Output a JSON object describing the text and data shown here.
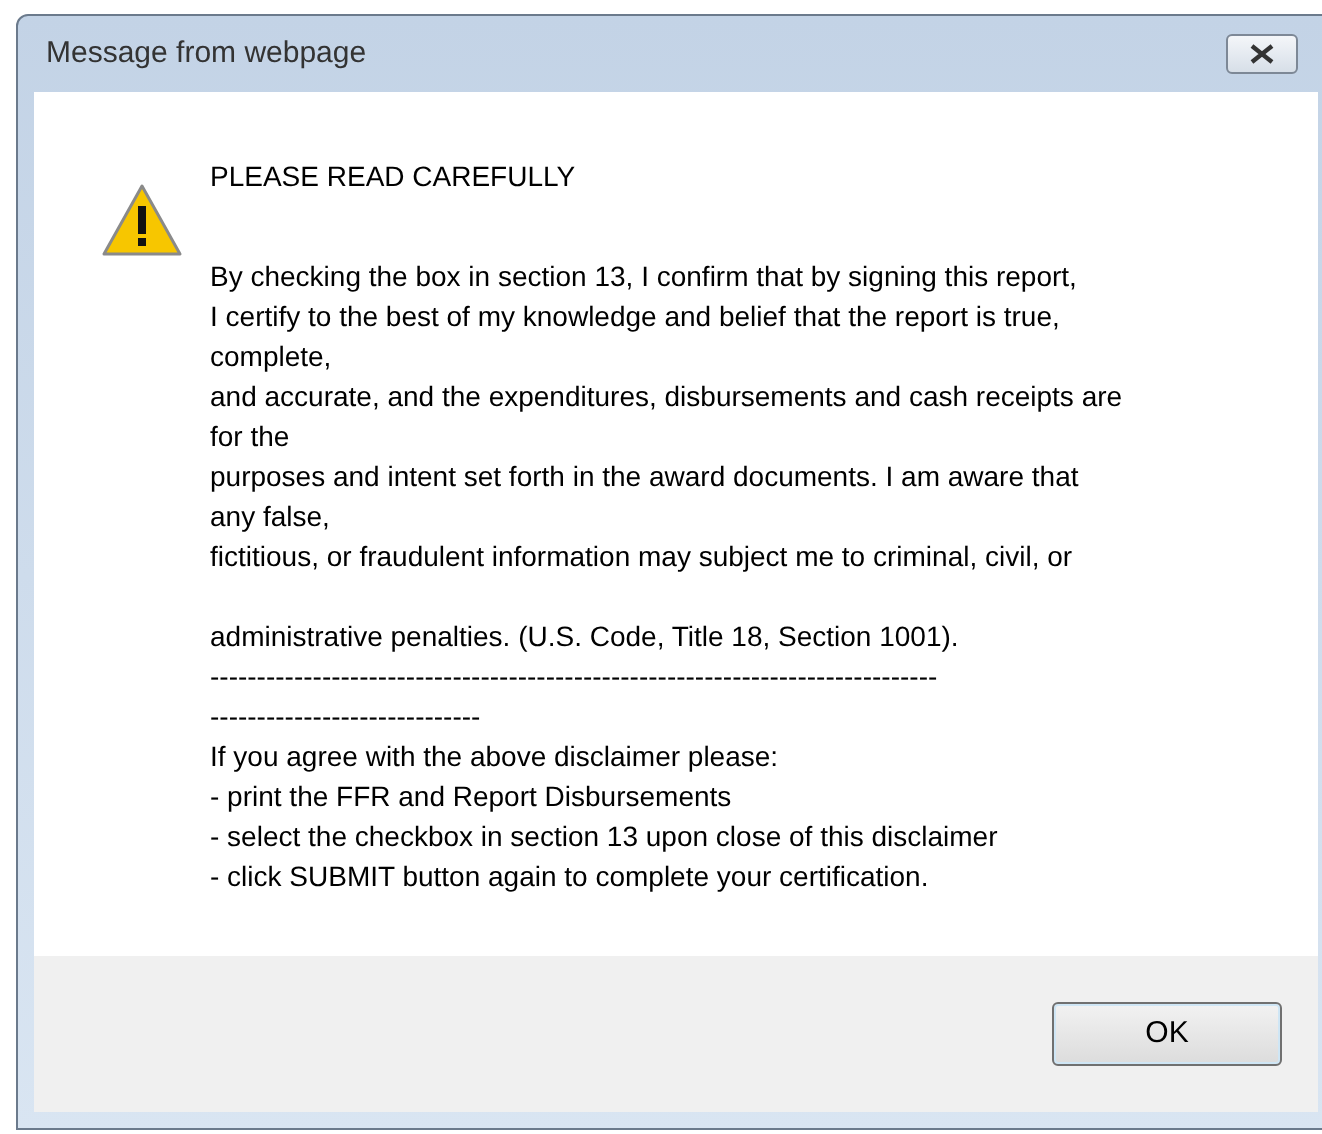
{
  "window": {
    "title": "Message from webpage"
  },
  "heading": "PLEASE READ CAREFULLY",
  "paragraphs": [
    [
      "By checking the box in section 13, I confirm that by signing this report,",
      "I certify to the best of my knowledge and belief that the report is true,",
      "complete,",
      "and accurate, and the expenditures, disbursements and cash receipts are",
      "for the",
      "purposes and intent set forth in the award documents. I am aware that",
      "any false,",
      "fictitious, or fraudulent information may subject me to criminal, civil, or"
    ],
    [
      "administrative penalties. (U.S. Code, Title 18, Section 1001).",
      "------------------------------------------------------------------------------",
      "-----------------------------",
      "If you agree with the above disclaimer please:",
      "- print the FFR and Report Disbursements",
      "- select the checkbox in section 13 upon close of this disclaimer",
      "- click SUBMIT button again to complete your certification."
    ]
  ],
  "buttons": [
    {
      "label": "OK"
    }
  ]
}
